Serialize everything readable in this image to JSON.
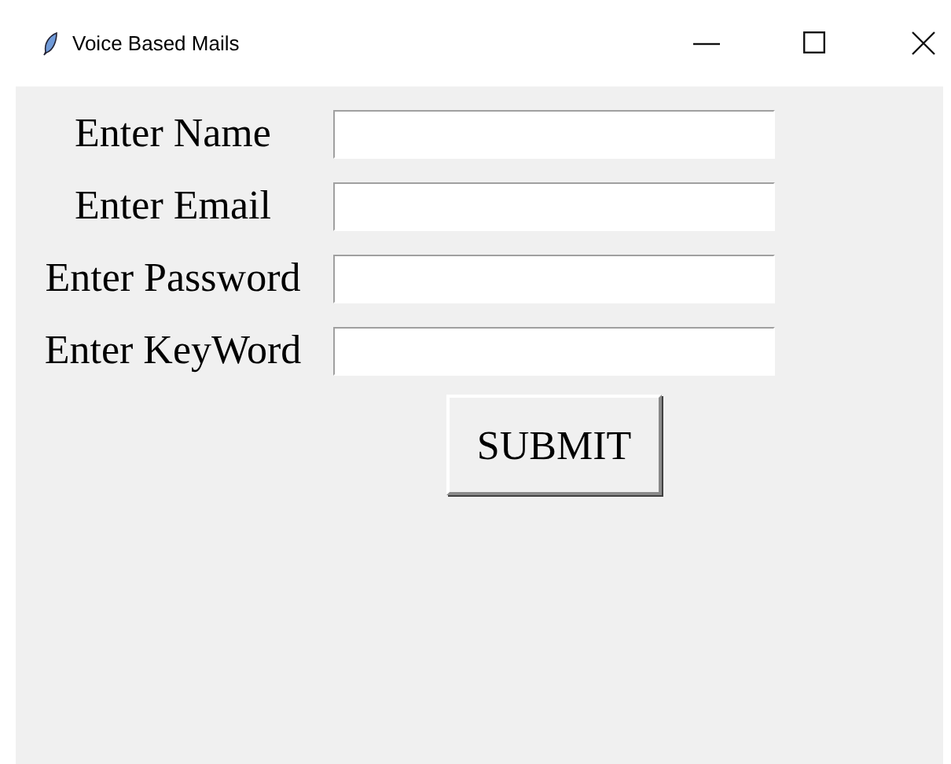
{
  "window": {
    "title": "Voice Based Mails"
  },
  "fields": [
    {
      "label": "Enter Name"
    },
    {
      "label": "Enter Email"
    },
    {
      "label": "Enter Password"
    },
    {
      "label": "Enter KeyWord"
    }
  ],
  "buttons": [
    "SUBMIT"
  ]
}
